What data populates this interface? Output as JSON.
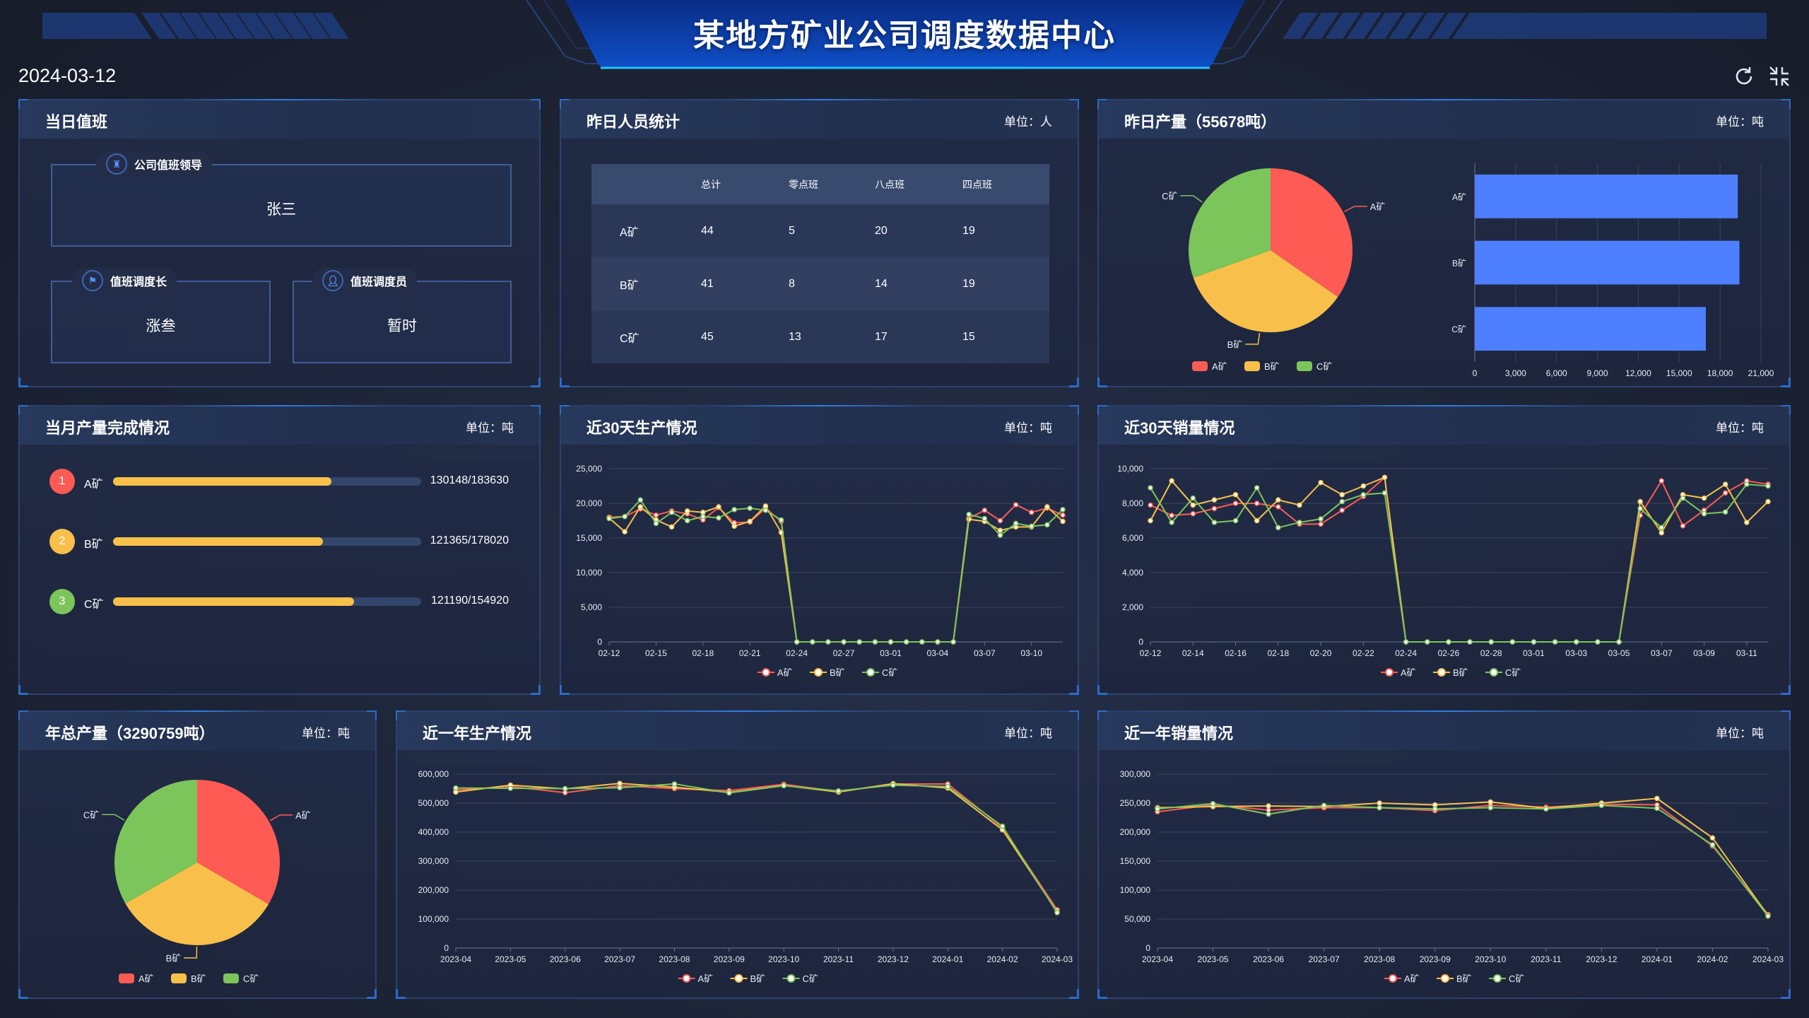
{
  "header": {
    "title": "某地方矿业公司调度数据中心",
    "date": "2024-03-12",
    "icons": [
      "refresh-icon",
      "fullscreen-exit-icon"
    ]
  },
  "colors": {
    "A": "#ff5b55",
    "B": "#f8c04a",
    "C": "#7cc55a",
    "bar": "#4e7fff",
    "accent": "#2f7fe6"
  },
  "duty": {
    "title": "当日值班",
    "leader": {
      "label": "公司值班领导",
      "name": "张三",
      "icon": "badge-icon"
    },
    "chief": {
      "label": "值班调度长",
      "name": "涨叁",
      "icon": "flag-icon"
    },
    "dispatcher": {
      "label": "值班调度员",
      "name": "暂时",
      "icon": "user-icon"
    }
  },
  "staff": {
    "title": "昨日人员统计",
    "unit": "单位：人",
    "columns": [
      "",
      "总计",
      "零点班",
      "八点班",
      "四点班"
    ],
    "rows": [
      {
        "mine": "A矿",
        "values": [
          "44",
          "5",
          "20",
          "19"
        ]
      },
      {
        "mine": "B矿",
        "values": [
          "41",
          "8",
          "14",
          "19"
        ]
      },
      {
        "mine": "C矿",
        "values": [
          "45",
          "13",
          "17",
          "15"
        ]
      }
    ]
  },
  "yesterday": {
    "title": "昨日产量（55678吨）",
    "unit": "单位：吨"
  },
  "monthly": {
    "title": "当月产量完成情况",
    "unit": "单位：吨",
    "items": [
      {
        "rank": "1",
        "mine": "A矿",
        "value": "130148/183630",
        "progress": 0.7087
      },
      {
        "rank": "2",
        "mine": "B矿",
        "value": "121365/178020",
        "progress": 0.6818
      },
      {
        "rank": "3",
        "mine": "C矿",
        "value": "121190/154920",
        "progress": 0.7823
      }
    ]
  },
  "prod30": {
    "title": "近30天生产情况",
    "unit": "单位：吨"
  },
  "sales30": {
    "title": "近30天销量情况",
    "unit": "单位：吨"
  },
  "year": {
    "title": "年总产量（3290759吨）",
    "unit": "单位：吨"
  },
  "prod12": {
    "title": "近一年生产情况",
    "unit": "单位：吨"
  },
  "sales12": {
    "title": "近一年销量情况",
    "unit": "单位：吨"
  },
  "chart_data": [
    {
      "type": "pie",
      "labels": [
        "A矿",
        "B矿",
        "C矿"
      ],
      "values": [
        19300,
        19420,
        16958
      ],
      "legend": "bottom"
    },
    {
      "type": "bar",
      "orientation": "horizontal",
      "categories": [
        "A矿",
        "B矿",
        "C矿"
      ],
      "values": [
        19300,
        19420,
        16958
      ],
      "xlim": [
        0,
        21000
      ],
      "xticks": [
        0,
        3000,
        6000,
        9000,
        12000,
        15000,
        18000,
        21000
      ],
      "grid": true
    },
    {
      "type": "line",
      "legend": "bottom",
      "ylim": [
        0,
        25000
      ],
      "yticks": [
        0,
        5000,
        10000,
        15000,
        20000,
        25000
      ],
      "x": [
        "02-12",
        "02-13",
        "02-14",
        "02-15",
        "02-16",
        "02-17",
        "02-18",
        "02-19",
        "02-20",
        "02-21",
        "02-22",
        "02-23",
        "02-24",
        "02-25",
        "02-26",
        "02-27",
        "02-28",
        "02-29",
        "03-01",
        "03-02",
        "03-03",
        "03-04",
        "03-05",
        "03-06",
        "03-07",
        "03-08",
        "03-09",
        "03-10",
        "03-11",
        "03-12"
      ],
      "series": [
        {
          "name": "A矿",
          "values": [
            18000,
            18100,
            19200,
            18300,
            18900,
            18500,
            17600,
            19400,
            17200,
            17300,
            19300,
            17400,
            0,
            0,
            0,
            0,
            0,
            0,
            0,
            0,
            0,
            0,
            0,
            17800,
            19000,
            17500,
            19800,
            18700,
            19300,
            18300
          ]
        },
        {
          "name": "B矿",
          "values": [
            17900,
            15900,
            19500,
            17600,
            16600,
            18900,
            18700,
            19500,
            16700,
            17400,
            19600,
            15800,
            0,
            0,
            0,
            0,
            0,
            0,
            0,
            0,
            0,
            0,
            0,
            17700,
            17400,
            16100,
            16600,
            16600,
            19500,
            17400
          ]
        },
        {
          "name": "C矿",
          "values": [
            17800,
            18100,
            20500,
            17100,
            18700,
            17500,
            18100,
            17900,
            19100,
            19300,
            19000,
            17600,
            0,
            0,
            0,
            0,
            0,
            0,
            0,
            0,
            0,
            0,
            0,
            18400,
            17800,
            15400,
            17100,
            16700,
            16900,
            19100
          ]
        }
      ]
    },
    {
      "type": "line",
      "legend": "bottom",
      "ylim": [
        0,
        10000
      ],
      "yticks": [
        0,
        2000,
        4000,
        6000,
        8000,
        10000
      ],
      "x": [
        "02-12",
        "02-13",
        "02-14",
        "02-15",
        "02-16",
        "02-17",
        "02-18",
        "02-19",
        "02-20",
        "02-21",
        "02-22",
        "02-23",
        "02-24",
        "02-25",
        "02-26",
        "02-27",
        "02-28",
        "02-29",
        "03-01",
        "03-02",
        "03-03",
        "03-04",
        "03-05",
        "03-06",
        "03-07",
        "03-08",
        "03-09",
        "03-10",
        "03-11",
        "03-12"
      ],
      "series": [
        {
          "name": "A矿",
          "values": [
            7900,
            7300,
            7400,
            7700,
            8000,
            8000,
            7800,
            6800,
            6800,
            7600,
            8400,
            9500,
            0,
            0,
            0,
            0,
            0,
            0,
            0,
            0,
            0,
            0,
            0,
            7300,
            9300,
            6700,
            7600,
            8600,
            9300,
            9100
          ]
        },
        {
          "name": "B矿",
          "values": [
            7000,
            9300,
            7900,
            8200,
            8500,
            7000,
            8200,
            7900,
            9200,
            8500,
            9000,
            9500,
            0,
            0,
            0,
            0,
            0,
            0,
            0,
            0,
            0,
            0,
            0,
            8100,
            6300,
            8500,
            8300,
            9100,
            6900,
            8100
          ]
        },
        {
          "name": "C矿",
          "values": [
            8900,
            6900,
            8300,
            6900,
            7000,
            8900,
            6600,
            6900,
            7100,
            8100,
            8500,
            8600,
            0,
            0,
            0,
            0,
            0,
            0,
            0,
            0,
            0,
            0,
            0,
            7700,
            6600,
            8300,
            7400,
            7500,
            9100,
            9000
          ]
        }
      ]
    },
    {
      "type": "pie",
      "labels": [
        "A矿",
        "B矿",
        "C矿"
      ],
      "values": [
        1100000,
        1096000,
        1094759
      ],
      "legend": "bottom"
    },
    {
      "type": "line",
      "legend": "bottom",
      "ylim": [
        0,
        600000
      ],
      "yticks": [
        0,
        100000,
        200000,
        300000,
        400000,
        500000,
        600000
      ],
      "x": [
        "2023-04",
        "2023-05",
        "2023-06",
        "2023-07",
        "2023-08",
        "2023-09",
        "2023-10",
        "2023-11",
        "2023-12",
        "2024-01",
        "2024-02",
        "2024-03"
      ],
      "series": [
        {
          "name": "A矿",
          "values": [
            545000,
            557000,
            536000,
            560000,
            550000,
            543000,
            565000,
            540000,
            566000,
            566000,
            415000,
            132000
          ]
        },
        {
          "name": "B矿",
          "values": [
            538000,
            562000,
            549000,
            568000,
            555000,
            537000,
            561000,
            538000,
            567000,
            552000,
            408000,
            125000
          ]
        },
        {
          "name": "C矿",
          "values": [
            552000,
            551000,
            550000,
            553000,
            566000,
            535000,
            560000,
            542000,
            562000,
            557000,
            420000,
            122000
          ]
        }
      ]
    },
    {
      "type": "line",
      "legend": "bottom",
      "ylim": [
        0,
        300000
      ],
      "yticks": [
        0,
        50000,
        100000,
        150000,
        200000,
        250000,
        300000
      ],
      "x": [
        "2023-04",
        "2023-05",
        "2023-06",
        "2023-07",
        "2023-08",
        "2023-09",
        "2023-10",
        "2023-11",
        "2023-12",
        "2024-01",
        "2024-02",
        "2024-03"
      ],
      "series": [
        {
          "name": "A矿",
          "values": [
            235000,
            247000,
            238000,
            242000,
            242000,
            237000,
            246000,
            243000,
            248000,
            247000,
            176000,
            58000
          ]
        },
        {
          "name": "B矿",
          "values": [
            242000,
            244000,
            245000,
            244000,
            250000,
            247000,
            252000,
            241000,
            250000,
            258000,
            190000,
            56000
          ]
        },
        {
          "name": "C矿",
          "values": [
            240000,
            249000,
            231000,
            246000,
            242000,
            240000,
            242000,
            240000,
            246000,
            241000,
            178000,
            55000
          ]
        }
      ]
    }
  ]
}
